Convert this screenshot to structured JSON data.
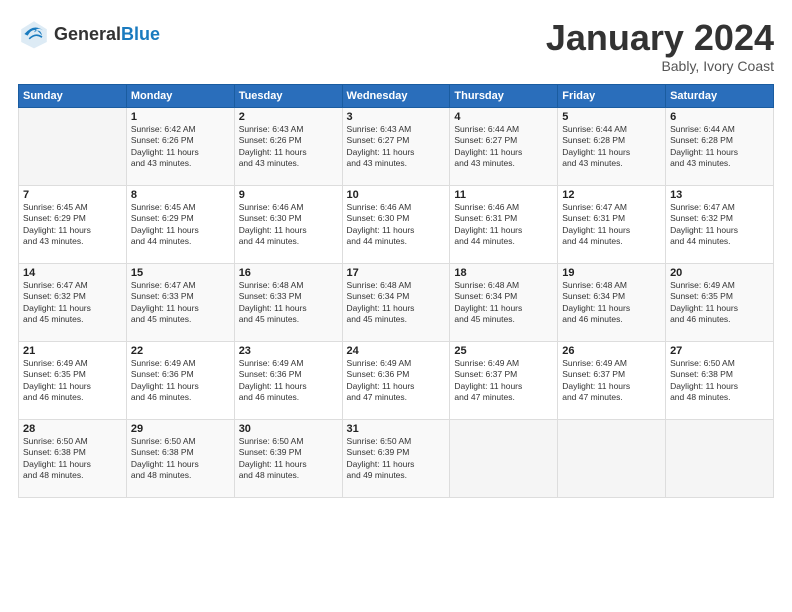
{
  "header": {
    "logo_general": "General",
    "logo_blue": "Blue",
    "month_title": "January 2024",
    "subtitle": "Bably, Ivory Coast"
  },
  "days_of_week": [
    "Sunday",
    "Monday",
    "Tuesday",
    "Wednesday",
    "Thursday",
    "Friday",
    "Saturday"
  ],
  "weeks": [
    [
      {
        "day": "",
        "info": ""
      },
      {
        "day": "1",
        "info": "Sunrise: 6:42 AM\nSunset: 6:26 PM\nDaylight: 11 hours\nand 43 minutes."
      },
      {
        "day": "2",
        "info": "Sunrise: 6:43 AM\nSunset: 6:26 PM\nDaylight: 11 hours\nand 43 minutes."
      },
      {
        "day": "3",
        "info": "Sunrise: 6:43 AM\nSunset: 6:27 PM\nDaylight: 11 hours\nand 43 minutes."
      },
      {
        "day": "4",
        "info": "Sunrise: 6:44 AM\nSunset: 6:27 PM\nDaylight: 11 hours\nand 43 minutes."
      },
      {
        "day": "5",
        "info": "Sunrise: 6:44 AM\nSunset: 6:28 PM\nDaylight: 11 hours\nand 43 minutes."
      },
      {
        "day": "6",
        "info": "Sunrise: 6:44 AM\nSunset: 6:28 PM\nDaylight: 11 hours\nand 43 minutes."
      }
    ],
    [
      {
        "day": "7",
        "info": "Sunrise: 6:45 AM\nSunset: 6:29 PM\nDaylight: 11 hours\nand 43 minutes."
      },
      {
        "day": "8",
        "info": "Sunrise: 6:45 AM\nSunset: 6:29 PM\nDaylight: 11 hours\nand 44 minutes."
      },
      {
        "day": "9",
        "info": "Sunrise: 6:46 AM\nSunset: 6:30 PM\nDaylight: 11 hours\nand 44 minutes."
      },
      {
        "day": "10",
        "info": "Sunrise: 6:46 AM\nSunset: 6:30 PM\nDaylight: 11 hours\nand 44 minutes."
      },
      {
        "day": "11",
        "info": "Sunrise: 6:46 AM\nSunset: 6:31 PM\nDaylight: 11 hours\nand 44 minutes."
      },
      {
        "day": "12",
        "info": "Sunrise: 6:47 AM\nSunset: 6:31 PM\nDaylight: 11 hours\nand 44 minutes."
      },
      {
        "day": "13",
        "info": "Sunrise: 6:47 AM\nSunset: 6:32 PM\nDaylight: 11 hours\nand 44 minutes."
      }
    ],
    [
      {
        "day": "14",
        "info": "Sunrise: 6:47 AM\nSunset: 6:32 PM\nDaylight: 11 hours\nand 45 minutes."
      },
      {
        "day": "15",
        "info": "Sunrise: 6:47 AM\nSunset: 6:33 PM\nDaylight: 11 hours\nand 45 minutes."
      },
      {
        "day": "16",
        "info": "Sunrise: 6:48 AM\nSunset: 6:33 PM\nDaylight: 11 hours\nand 45 minutes."
      },
      {
        "day": "17",
        "info": "Sunrise: 6:48 AM\nSunset: 6:34 PM\nDaylight: 11 hours\nand 45 minutes."
      },
      {
        "day": "18",
        "info": "Sunrise: 6:48 AM\nSunset: 6:34 PM\nDaylight: 11 hours\nand 45 minutes."
      },
      {
        "day": "19",
        "info": "Sunrise: 6:48 AM\nSunset: 6:34 PM\nDaylight: 11 hours\nand 46 minutes."
      },
      {
        "day": "20",
        "info": "Sunrise: 6:49 AM\nSunset: 6:35 PM\nDaylight: 11 hours\nand 46 minutes."
      }
    ],
    [
      {
        "day": "21",
        "info": "Sunrise: 6:49 AM\nSunset: 6:35 PM\nDaylight: 11 hours\nand 46 minutes."
      },
      {
        "day": "22",
        "info": "Sunrise: 6:49 AM\nSunset: 6:36 PM\nDaylight: 11 hours\nand 46 minutes."
      },
      {
        "day": "23",
        "info": "Sunrise: 6:49 AM\nSunset: 6:36 PM\nDaylight: 11 hours\nand 46 minutes."
      },
      {
        "day": "24",
        "info": "Sunrise: 6:49 AM\nSunset: 6:36 PM\nDaylight: 11 hours\nand 47 minutes."
      },
      {
        "day": "25",
        "info": "Sunrise: 6:49 AM\nSunset: 6:37 PM\nDaylight: 11 hours\nand 47 minutes."
      },
      {
        "day": "26",
        "info": "Sunrise: 6:49 AM\nSunset: 6:37 PM\nDaylight: 11 hours\nand 47 minutes."
      },
      {
        "day": "27",
        "info": "Sunrise: 6:50 AM\nSunset: 6:38 PM\nDaylight: 11 hours\nand 48 minutes."
      }
    ],
    [
      {
        "day": "28",
        "info": "Sunrise: 6:50 AM\nSunset: 6:38 PM\nDaylight: 11 hours\nand 48 minutes."
      },
      {
        "day": "29",
        "info": "Sunrise: 6:50 AM\nSunset: 6:38 PM\nDaylight: 11 hours\nand 48 minutes."
      },
      {
        "day": "30",
        "info": "Sunrise: 6:50 AM\nSunset: 6:39 PM\nDaylight: 11 hours\nand 48 minutes."
      },
      {
        "day": "31",
        "info": "Sunrise: 6:50 AM\nSunset: 6:39 PM\nDaylight: 11 hours\nand 49 minutes."
      },
      {
        "day": "",
        "info": ""
      },
      {
        "day": "",
        "info": ""
      },
      {
        "day": "",
        "info": ""
      }
    ]
  ]
}
